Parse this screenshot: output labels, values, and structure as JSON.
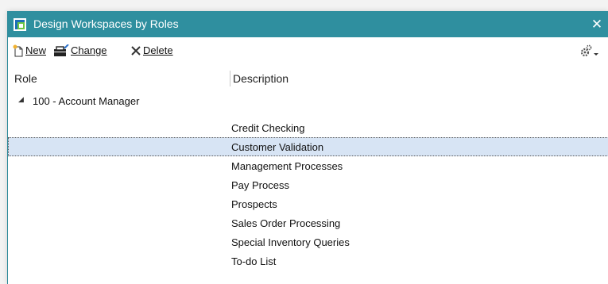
{
  "window": {
    "title": "Design Workspaces by Roles",
    "close_glyph": "✕",
    "accent": "#2f8f9f"
  },
  "toolbar": {
    "new_label": "New",
    "change_label": "Change",
    "delete_label": "Delete",
    "new_icon": "new-document-icon",
    "change_icon": "change-icon",
    "delete_icon": "delete-x-icon",
    "settings_icon": "gear-icon"
  },
  "table": {
    "columns": [
      "Role",
      "Description"
    ],
    "group": {
      "label": "100 - Account Manager",
      "expanded": true,
      "rows": [
        "Credit Checking",
        "Customer Validation",
        "Management Processes",
        "Pay Process",
        "Prospects",
        "Sales Order Processing",
        "Special Inventory Queries",
        "To-do List"
      ],
      "selected_index": 1
    }
  },
  "colors": {
    "selection": "#d7e4f4",
    "titlebar": "#2f8f9f"
  }
}
